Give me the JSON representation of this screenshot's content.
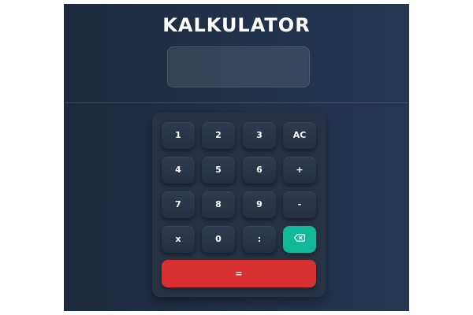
{
  "app": {
    "title": "KALKULATOR",
    "display_value": ""
  },
  "keypad": {
    "keys": [
      {
        "label": "1"
      },
      {
        "label": "2"
      },
      {
        "label": "3"
      },
      {
        "label": "AC"
      },
      {
        "label": "4"
      },
      {
        "label": "5"
      },
      {
        "label": "6"
      },
      {
        "label": "+"
      },
      {
        "label": "7"
      },
      {
        "label": "8"
      },
      {
        "label": "9"
      },
      {
        "label": "-"
      },
      {
        "label": "x"
      },
      {
        "label": "0"
      },
      {
        "label": ":"
      }
    ],
    "backspace_icon": "backspace-icon",
    "equals_label": "="
  },
  "colors": {
    "background": "#1e2d41",
    "keypad": "#263446",
    "backspace": "#12b89a",
    "equals": "#d93131"
  }
}
